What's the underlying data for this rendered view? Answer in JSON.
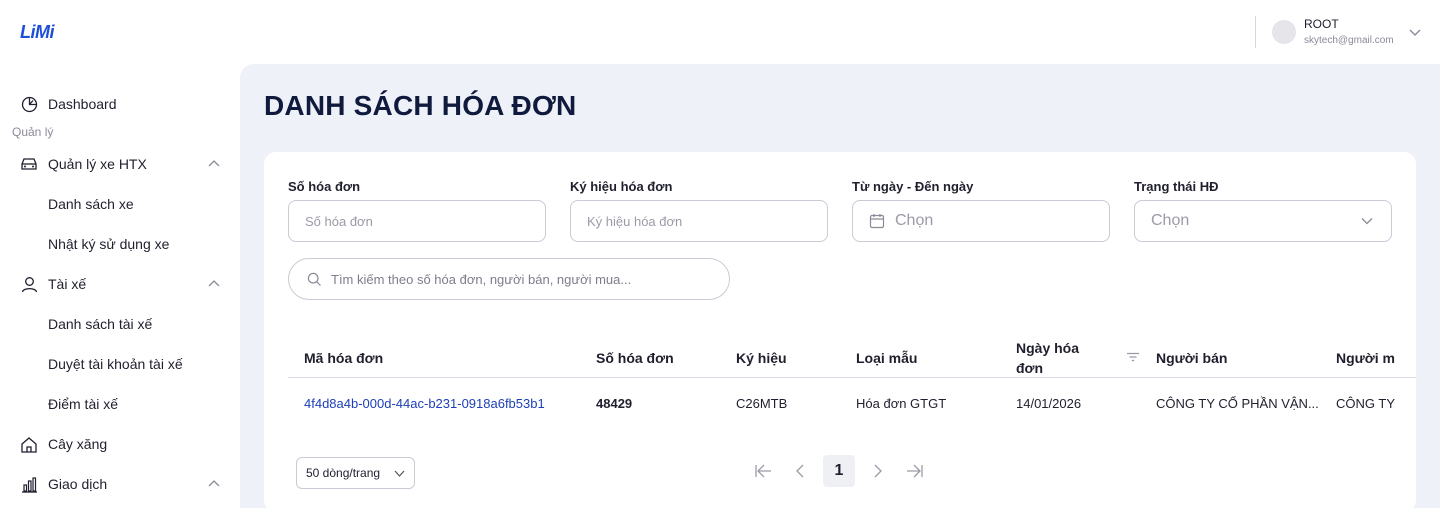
{
  "app": {
    "logo": "LiMi"
  },
  "user": {
    "name": "ROOT",
    "email": "skytech@gmail.com"
  },
  "sidebar": {
    "dashboard": "Dashboard",
    "group_label": "Quản lý",
    "items": [
      {
        "label": "Quản lý xe HTX",
        "icon": "car-icon"
      },
      {
        "label": "Danh sách xe"
      },
      {
        "label": "Nhật ký sử dụng xe"
      },
      {
        "label": "Tài xế",
        "icon": "user-icon"
      },
      {
        "label": "Danh sách tài xế"
      },
      {
        "label": "Duyệt tài khoản tài xế"
      },
      {
        "label": "Điểm tài xế"
      },
      {
        "label": "Cây xăng",
        "icon": "home-icon"
      },
      {
        "label": "Giao dịch",
        "icon": "bar-chart-icon"
      }
    ]
  },
  "page": {
    "title": "DANH SÁCH HÓA ĐƠN"
  },
  "filters": {
    "invoice_no": {
      "label": "Số hóa đơn",
      "placeholder": "Số hóa đơn",
      "value": ""
    },
    "symbol": {
      "label": "Ký hiệu hóa đơn",
      "placeholder": "Ký hiệu hóa đơn",
      "value": ""
    },
    "date_range": {
      "label": "Từ ngày - Đến ngày",
      "placeholder": "Chọn"
    },
    "status": {
      "label": "Trạng thái HĐ",
      "placeholder": "Chọn"
    },
    "search": {
      "placeholder": "Tìm kiếm theo số hóa đơn, người bán, người mua..."
    }
  },
  "table": {
    "columns": [
      "Mã hóa đơn",
      "Số hóa đơn",
      "Ký hiệu",
      "Loại mẫu",
      "Ngày hóa",
      "đơn",
      "Người bán",
      "Người m"
    ],
    "rows": [
      {
        "id": "4f4d8a4b-000d-44ac-b231-0918a6fb53b1",
        "number": "48429",
        "symbol": "C26MTB",
        "type": "Hóa đơn GTGT",
        "date": "14/01/2026",
        "seller": "CÔNG TY CỔ PHẦN VẬN...",
        "buyer": "CÔNG TY"
      }
    ]
  },
  "pagination": {
    "page_size": "50 dòng/trang",
    "current": "1"
  },
  "colors": {
    "accent": "#1d3fb8",
    "main_bg": "#eef1f8",
    "title": "#0f1a3d"
  }
}
